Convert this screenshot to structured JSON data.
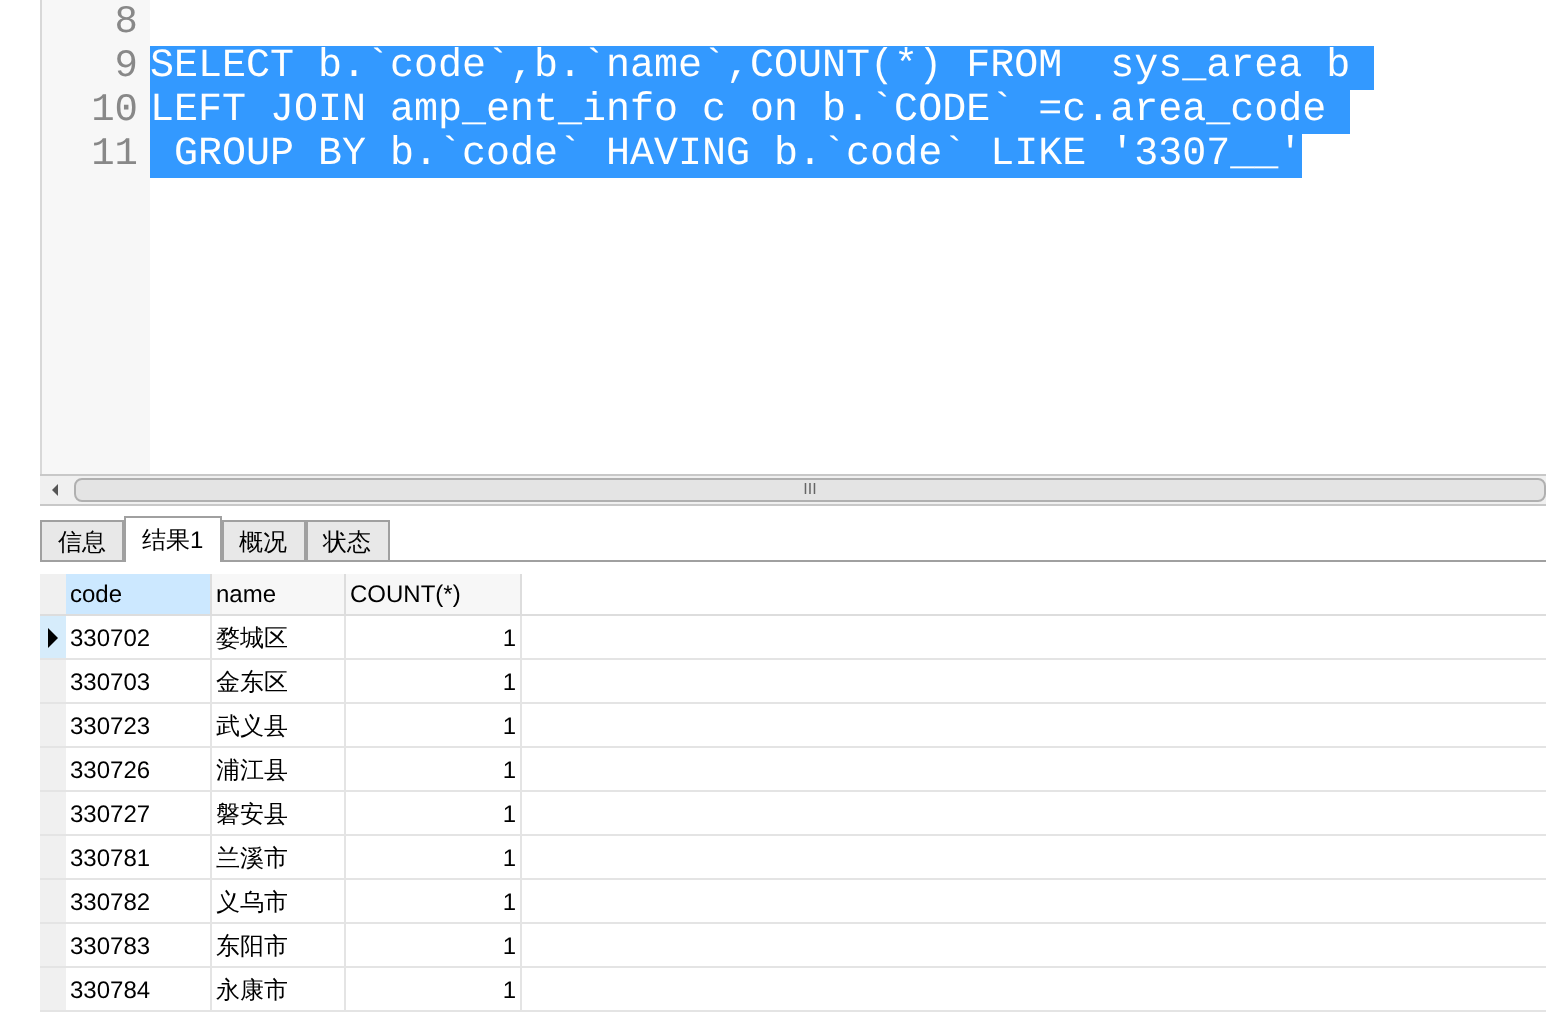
{
  "editor": {
    "lines": [
      {
        "number": "8"
      },
      {
        "number": "9",
        "text": "SELECT b.`code`,b.`name`,COUNT(*) FROM  sys_area b ",
        "selected": true
      },
      {
        "number": "10",
        "text": "LEFT JOIN amp_ent_info c on b.`CODE` =c.area_code ",
        "selected": true
      },
      {
        "number": "11",
        "text": " GROUP BY b.`code` HAVING b.`code` LIKE '3307__'",
        "selected": true
      }
    ]
  },
  "scroll_grip": "III",
  "tabs": [
    {
      "label": "信息",
      "selected": false
    },
    {
      "label": "结果1",
      "selected": true
    },
    {
      "label": "概况",
      "selected": false
    },
    {
      "label": "状态",
      "selected": false
    }
  ],
  "table": {
    "columns": [
      {
        "label": "code",
        "selected": true
      },
      {
        "label": "name",
        "selected": false
      },
      {
        "label": "COUNT(*)",
        "selected": false
      }
    ],
    "rows": [
      {
        "cells": [
          "330702",
          "婺城区",
          "1"
        ],
        "current": true
      },
      {
        "cells": [
          "330703",
          "金东区",
          "1"
        ],
        "current": false
      },
      {
        "cells": [
          "330723",
          "武义县",
          "1"
        ],
        "current": false
      },
      {
        "cells": [
          "330726",
          "浦江县",
          "1"
        ],
        "current": false
      },
      {
        "cells": [
          "330727",
          "磐安县",
          "1"
        ],
        "current": false
      },
      {
        "cells": [
          "330781",
          "兰溪市",
          "1"
        ],
        "current": false
      },
      {
        "cells": [
          "330782",
          "义乌市",
          "1"
        ],
        "current": false
      },
      {
        "cells": [
          "330783",
          "东阳市",
          "1"
        ],
        "current": false
      },
      {
        "cells": [
          "330784",
          "永康市",
          "1"
        ],
        "current": false
      }
    ]
  }
}
